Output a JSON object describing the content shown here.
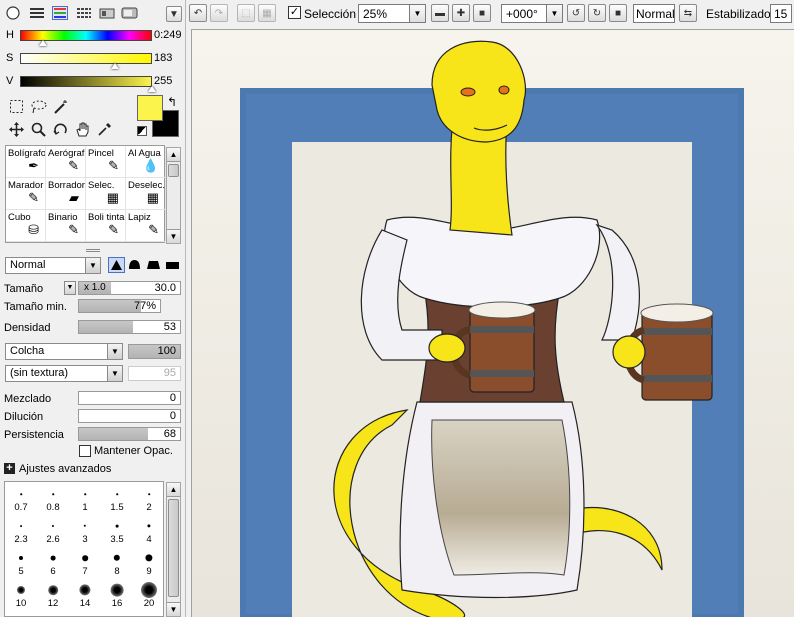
{
  "toolbar": {
    "selection_label": "Selección",
    "selection_checked": true,
    "zoom_value": "25%",
    "rotation_value": "+000°",
    "blend_mode": "Normal",
    "stabilizer_label": "Estabilizador",
    "stabilizer_value": "15"
  },
  "color_sliders": {
    "h_label": "H",
    "h_value": "0:249",
    "s_label": "S",
    "s_value": "183",
    "v_label": "V",
    "v_value": "255",
    "h_level": 0.175,
    "s_level": 0.72,
    "v_level": 1.0
  },
  "colors": {
    "foreground": "#fbf44d",
    "background": "#000000"
  },
  "brushes": [
    {
      "label": "Bolígrafo",
      "icon": "pen-icon"
    },
    {
      "label": "Aerógraf",
      "icon": "airbrush-icon"
    },
    {
      "label": "Pincel",
      "icon": "brush-icon"
    },
    {
      "label": "Al Agua",
      "icon": "watercolor-icon"
    },
    {
      "label": "Marador",
      "icon": "marker-icon"
    },
    {
      "label": "Borrador",
      "icon": "eraser-icon"
    },
    {
      "label": "Selec.",
      "icon": "select-brush-icon"
    },
    {
      "label": "Deselec.",
      "icon": "deselect-brush-icon"
    },
    {
      "label": "Cubo",
      "icon": "bucket-icon"
    },
    {
      "label": "Binario",
      "icon": "binary-icon"
    },
    {
      "label": "Boli tinta",
      "icon": "ink-pen-icon"
    },
    {
      "label": "Lapiz",
      "icon": "pencil-icon"
    }
  ],
  "brush_props": {
    "blend_mode": "Normal",
    "size_label": "Tamaño",
    "size_multiplier": "x 1.0",
    "size_value": "30.0",
    "min_size_label": "Tamaño min.",
    "min_size_value": "77%",
    "density_label": "Densidad",
    "density_value": "53",
    "shape_select": "Colcha",
    "shape_value": "100",
    "texture_select": "(sin textura)",
    "texture_value": "95",
    "blend_label": "Mezclado",
    "blend_value": "0",
    "dilution_label": "Dilución",
    "dilution_value": "0",
    "persistence_label": "Persistencia",
    "persistence_value": "68",
    "keep_opacity_label": "Mantener Opac.",
    "advanced_label": "Ajustes avanzados"
  },
  "size_presets": [
    "0.7",
    "0.8",
    "1",
    "1.5",
    "2",
    "2.3",
    "2.6",
    "3",
    "3.5",
    "4",
    "5",
    "6",
    "7",
    "8",
    "9",
    "10",
    "12",
    "14",
    "16",
    "20"
  ]
}
